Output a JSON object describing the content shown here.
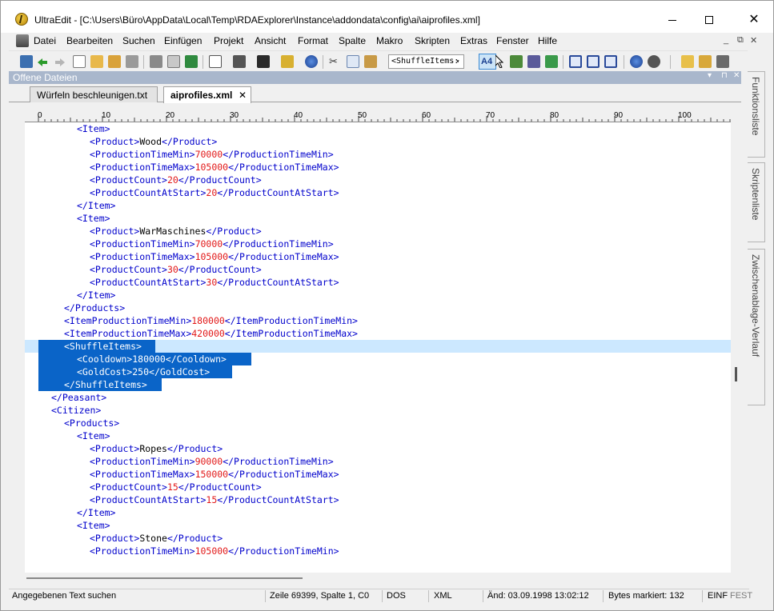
{
  "window": {
    "title": "UltraEdit - [C:\\Users\\Büro\\AppData\\Local\\Temp\\RDAExplorer\\Instance\\addondata\\config\\ai\\aiprofiles.xml]",
    "controls": {
      "minimize": "–",
      "maximize": "□",
      "close": "✕"
    }
  },
  "menubar": {
    "items": [
      "Datei",
      "Bearbeiten",
      "Suchen",
      "Einfügen",
      "Projekt",
      "Ansicht",
      "Format",
      "Spalte",
      "Makro",
      "Skripten",
      "Extras",
      "Fenster",
      "Hilfe"
    ],
    "mdi_controls": [
      "_",
      "⧉",
      "✕"
    ]
  },
  "toolbar": {
    "combo_value": "<ShuffleItems:",
    "combo_arrow": "▾"
  },
  "open_files_panel": {
    "title": "Offene Dateien",
    "controls": [
      "▾",
      "⊓",
      "✕"
    ],
    "tabs": [
      {
        "label": "Würfeln beschleunigen.txt",
        "active": false
      },
      {
        "label": "aiprofiles.xml",
        "active": true,
        "close": "✕"
      }
    ]
  },
  "ruler": {
    "labels": [
      "0",
      "10",
      "20",
      "30",
      "40",
      "50",
      "60",
      "70",
      "80",
      "90",
      "100"
    ]
  },
  "editor": {
    "lines": [
      {
        "indent": 6,
        "fold": true,
        "parts": [
          [
            "tag",
            "<Item>"
          ]
        ]
      },
      {
        "indent": 8,
        "fold": false,
        "parts": [
          [
            "tag",
            "<Product>"
          ],
          [
            "txt",
            "Wood"
          ],
          [
            "tag",
            "</Product>"
          ]
        ]
      },
      {
        "indent": 8,
        "fold": false,
        "parts": [
          [
            "tag",
            "<ProductionTimeMin>"
          ],
          [
            "val",
            "70000"
          ],
          [
            "tag",
            "</ProductionTimeMin>"
          ]
        ]
      },
      {
        "indent": 8,
        "fold": false,
        "parts": [
          [
            "tag",
            "<ProductionTimeMax>"
          ],
          [
            "val",
            "105000"
          ],
          [
            "tag",
            "</ProductionTimeMax>"
          ]
        ]
      },
      {
        "indent": 8,
        "fold": false,
        "parts": [
          [
            "tag",
            "<ProductCount>"
          ],
          [
            "val",
            "20"
          ],
          [
            "tag",
            "</ProductCount>"
          ]
        ]
      },
      {
        "indent": 8,
        "fold": false,
        "parts": [
          [
            "tag",
            "<ProductCountAtStart>"
          ],
          [
            "val",
            "20"
          ],
          [
            "tag",
            "</ProductCountAtStart>"
          ]
        ]
      },
      {
        "indent": 6,
        "fold": false,
        "parts": [
          [
            "tag",
            "</Item>"
          ]
        ]
      },
      {
        "indent": 6,
        "fold": true,
        "parts": [
          [
            "tag",
            "<Item>"
          ]
        ]
      },
      {
        "indent": 8,
        "fold": false,
        "parts": [
          [
            "tag",
            "<Product>"
          ],
          [
            "txt",
            "WarMaschines"
          ],
          [
            "tag",
            "</Product>"
          ]
        ]
      },
      {
        "indent": 8,
        "fold": false,
        "parts": [
          [
            "tag",
            "<ProductionTimeMin>"
          ],
          [
            "val",
            "70000"
          ],
          [
            "tag",
            "</ProductionTimeMin>"
          ]
        ]
      },
      {
        "indent": 8,
        "fold": false,
        "parts": [
          [
            "tag",
            "<ProductionTimeMax>"
          ],
          [
            "val",
            "105000"
          ],
          [
            "tag",
            "</ProductionTimeMax>"
          ]
        ]
      },
      {
        "indent": 8,
        "fold": false,
        "parts": [
          [
            "tag",
            "<ProductCount>"
          ],
          [
            "val",
            "30"
          ],
          [
            "tag",
            "</ProductCount>"
          ]
        ]
      },
      {
        "indent": 8,
        "fold": false,
        "parts": [
          [
            "tag",
            "<ProductCountAtStart>"
          ],
          [
            "val",
            "30"
          ],
          [
            "tag",
            "</ProductCountAtStart>"
          ]
        ]
      },
      {
        "indent": 6,
        "fold": false,
        "parts": [
          [
            "tag",
            "</Item>"
          ]
        ]
      },
      {
        "indent": 4,
        "fold": false,
        "parts": [
          [
            "tag",
            "</Products>"
          ]
        ]
      },
      {
        "indent": 4,
        "fold": false,
        "parts": [
          [
            "tag",
            "<ItemProductionTimeMin>"
          ],
          [
            "val",
            "180000"
          ],
          [
            "tag",
            "</ItemProductionTimeMin>"
          ]
        ]
      },
      {
        "indent": 4,
        "fold": false,
        "parts": [
          [
            "tag",
            "<ItemProductionTimeMax>"
          ],
          [
            "val",
            "420000"
          ],
          [
            "tag",
            "</ItemProductionTimeMax>"
          ]
        ]
      },
      {
        "indent": 4,
        "fold": true,
        "selected": "full",
        "parts": [
          [
            "tag",
            "<ShuffleItems>"
          ]
        ]
      },
      {
        "indent": 6,
        "fold": false,
        "selected": "block",
        "parts": [
          [
            "tag",
            "<Cooldown>"
          ],
          [
            "val",
            "180000"
          ],
          [
            "tag",
            "</Cooldown>"
          ]
        ]
      },
      {
        "indent": 6,
        "fold": false,
        "selected": "block",
        "parts": [
          [
            "tag",
            "<GoldCost>"
          ],
          [
            "val",
            "250"
          ],
          [
            "tag",
            "</GoldCost>"
          ]
        ]
      },
      {
        "indent": 4,
        "fold": false,
        "selected": "block",
        "parts": [
          [
            "tag",
            "</ShuffleItems>"
          ]
        ]
      },
      {
        "indent": 2,
        "fold": false,
        "parts": [
          [
            "tag",
            "</Peasant>"
          ]
        ]
      },
      {
        "indent": 2,
        "fold": true,
        "parts": [
          [
            "tag",
            "<Citizen>"
          ]
        ]
      },
      {
        "indent": 4,
        "fold": true,
        "parts": [
          [
            "tag",
            "<Products>"
          ]
        ]
      },
      {
        "indent": 6,
        "fold": true,
        "parts": [
          [
            "tag",
            "<Item>"
          ]
        ]
      },
      {
        "indent": 8,
        "fold": false,
        "parts": [
          [
            "tag",
            "<Product>"
          ],
          [
            "txt",
            "Ropes"
          ],
          [
            "tag",
            "</Product>"
          ]
        ]
      },
      {
        "indent": 8,
        "fold": false,
        "parts": [
          [
            "tag",
            "<ProductionTimeMin>"
          ],
          [
            "val",
            "90000"
          ],
          [
            "tag",
            "</ProductionTimeMin>"
          ]
        ]
      },
      {
        "indent": 8,
        "fold": false,
        "parts": [
          [
            "tag",
            "<ProductionTimeMax>"
          ],
          [
            "val",
            "150000"
          ],
          [
            "tag",
            "</ProductionTimeMax>"
          ]
        ]
      },
      {
        "indent": 8,
        "fold": false,
        "parts": [
          [
            "tag",
            "<ProductCount>"
          ],
          [
            "val",
            "15"
          ],
          [
            "tag",
            "</ProductCount>"
          ]
        ]
      },
      {
        "indent": 8,
        "fold": false,
        "parts": [
          [
            "tag",
            "<ProductCountAtStart>"
          ],
          [
            "val",
            "15"
          ],
          [
            "tag",
            "</ProductCountAtStart>"
          ]
        ]
      },
      {
        "indent": 6,
        "fold": false,
        "parts": [
          [
            "tag",
            "</Item>"
          ]
        ]
      },
      {
        "indent": 6,
        "fold": true,
        "parts": [
          [
            "tag",
            "<Item>"
          ]
        ]
      },
      {
        "indent": 8,
        "fold": false,
        "parts": [
          [
            "tag",
            "<Product>"
          ],
          [
            "txt",
            "Stone"
          ],
          [
            "tag",
            "</Product>"
          ]
        ]
      },
      {
        "indent": 8,
        "fold": false,
        "parts": [
          [
            "tag",
            "<ProductionTimeMin>"
          ],
          [
            "val",
            "105000"
          ],
          [
            "tag",
            "</ProductionTimeMin>"
          ]
        ]
      }
    ]
  },
  "side_panels": [
    "Funktionsliste",
    "Skriptenliste",
    "Zwischenablage-Verlauf"
  ],
  "statusbar": {
    "message": "Angegebenen Text suchen",
    "position": "Zeile 69399, Spalte 1, C0",
    "line_ending": "DOS",
    "syntax": "XML",
    "modified": "Änd: 03.09.1998 13:02:12",
    "bytes_selected": "Bytes markiert: 132",
    "insert_mode": "EINF",
    "fixed_mode": "FEST"
  },
  "colors": {
    "tag": "#0000cc",
    "value": "#e21a1a",
    "selection": "#0a64c8",
    "current_line": "#cce8ff",
    "panel_header": "#a9b7cc"
  }
}
